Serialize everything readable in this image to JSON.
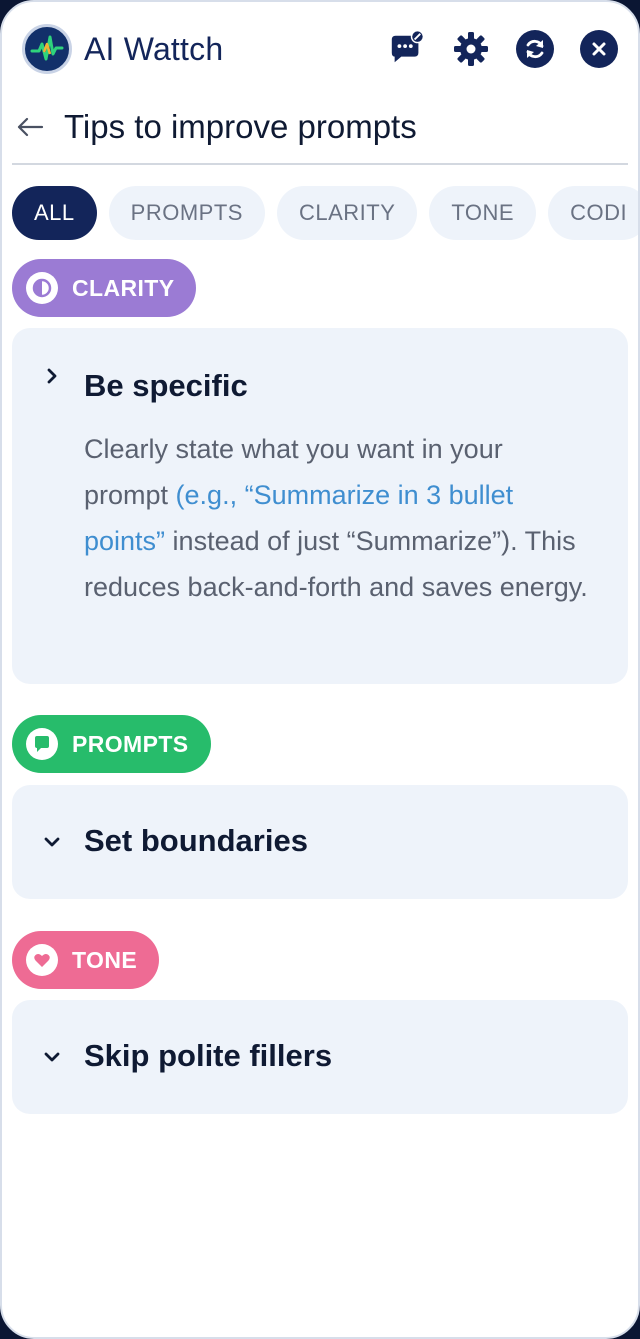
{
  "header": {
    "app_title": "AI Wattch",
    "logo_icon": "ai-wattch-logo",
    "actions": [
      {
        "name": "feedback-button",
        "icon": "chat-edit-icon"
      },
      {
        "name": "settings-button",
        "icon": "gear-icon"
      },
      {
        "name": "refresh-button",
        "icon": "refresh-icon"
      },
      {
        "name": "close-button",
        "icon": "close-icon"
      }
    ]
  },
  "page": {
    "title": "Tips to improve prompts",
    "back_icon": "arrow-left-icon"
  },
  "filters": [
    "ALL",
    "PROMPTS",
    "CLARITY",
    "TONE",
    "CODI"
  ],
  "active_filter": "ALL",
  "tips": [
    {
      "category": "CLARITY",
      "category_color": "#9b7bd4",
      "title": "Be specific",
      "expanded": true,
      "body_pre": "Clearly state what you want in your prompt ",
      "body_highlight": "(e.g., “Summarize in 3 bullet points”",
      "body_post": " instead of just “Summarize”). This reduces back-and-forth and saves energy."
    },
    {
      "category": "PROMPTS",
      "category_color": "#27bc6b",
      "title": "Set boundaries",
      "expanded": false
    },
    {
      "category": "TONE",
      "category_color": "#ee6b94",
      "title": "Skip polite fillers",
      "expanded": false
    }
  ],
  "colors": {
    "navy": "#13255a",
    "card_bg": "#eef3fa",
    "link": "#3f8ed0"
  }
}
